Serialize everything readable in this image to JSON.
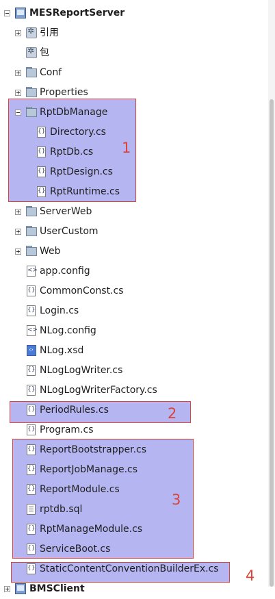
{
  "tree": {
    "project_label": "MESReportServer",
    "references_label": "引用",
    "packages_label": "包",
    "conf_folder": "Conf",
    "properties_folder": "Properties",
    "rptdbmanage_folder": "RptDbManage",
    "directory_file": "Directory.cs",
    "rptdb_file": "RptDb.cs",
    "rptdesign_file": "RptDesign.cs",
    "rptruntime_file": "RptRuntime.cs",
    "serverweb_folder": "ServerWeb",
    "usercustom_folder": "UserCustom",
    "web_folder": "Web",
    "appconfig_file": "app.config",
    "commonconst_file": "CommonConst.cs",
    "login_file": "Login.cs",
    "nlogconfig_file": "NLog.config",
    "nlogxsd_file": "NLog.xsd",
    "nloglogwriter_file": "NLogLogWriter.cs",
    "nloglogwriterfactory_file": "NLogLogWriterFactory.cs",
    "periodrules_file": "PeriodRules.cs",
    "program_file": "Program.cs",
    "reportbootstrapper_file": "ReportBootstrapper.cs",
    "reportjobmanage_file": "ReportJobManage.cs",
    "reportmodule_file": "ReportModule.cs",
    "rptdbsql_file": "rptdb.sql",
    "rptmanagemodule_file": "RptManageModule.cs",
    "serviceboot_file": "ServiceBoot.cs",
    "staticcontent_file": "StaticContentConventionBuilderEx.cs",
    "next_project_partial": "BMSClient"
  },
  "annotations": {
    "marker_1": "1",
    "marker_2": "2",
    "marker_3": "3",
    "marker_4": "4",
    "highlight_fill": "#7878e6",
    "highlight_border": "#d9443b"
  }
}
